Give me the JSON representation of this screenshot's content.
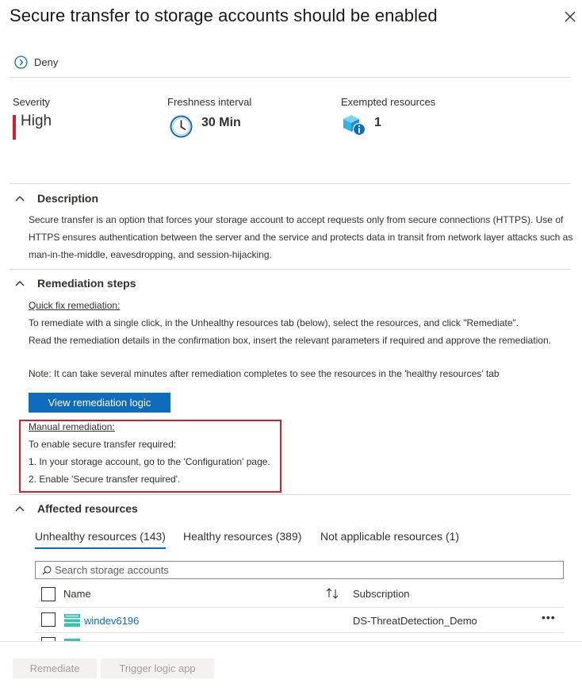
{
  "panel": {
    "title": "Secure transfer to storage accounts should be enabled",
    "effect": "Deny"
  },
  "metrics": {
    "severity_label": "Severity",
    "severity_value": "High",
    "freshness_label": "Freshness interval",
    "freshness_value": "30 Min",
    "exempted_label": "Exempted resources",
    "exempted_value": "1"
  },
  "description": {
    "heading": "Description",
    "lines": [
      "Secure transfer is an option that forces your storage account to accept requests only from secure connections (HTTPS). Use of",
      "HTTPS ensures authentication between the server and the service and protects data in transit from network layer attacks such as",
      "man-in-the-middle, eavesdropping, and session-hijacking."
    ]
  },
  "remediation": {
    "heading": "Remediation steps",
    "quick_fix_title": "Quick fix remediation:",
    "quick_fix_lines": [
      "To remediate with a single click, in the Unhealthy resources tab (below), select the resources, and click \"Remediate\".",
      "Read the remediation details in the confirmation box, insert the relevant parameters if required and approve the remediation."
    ],
    "note": "Note: It can take several minutes after remediation completes to see the resources in the 'healthy resources' tab",
    "button_label": "View remediation logic",
    "manual_title": "Manual remediation:",
    "manual_lines": [
      "To enable secure transfer required:",
      "1. In your storage account, go to the 'Configuration' page.",
      "2. Enable 'Secure transfer required'."
    ]
  },
  "affected": {
    "heading": "Affected resources",
    "tabs": [
      "Unhealthy resources (143)",
      "Healthy resources (389)",
      "Not applicable resources (1)"
    ],
    "search_placeholder": "Search storage accounts",
    "columns": {
      "name": "Name",
      "subscription": "Subscription"
    },
    "rows": [
      {
        "name": "windev6196",
        "subscription": "DS-ThreatDetection_Demo"
      }
    ]
  },
  "footer": {
    "remediate_label": "Remediate",
    "trigger_label": "Trigger logic app"
  },
  "colors": {
    "accent": "#0f6cbd",
    "severity_high": "#d3202c",
    "highlight_border": "#d3202c"
  },
  "icons": [
    "close-icon",
    "deny-icon",
    "clock-icon",
    "resource-info-icon",
    "chevron-up-icon",
    "search-icon",
    "sort-icon",
    "storage-account-icon",
    "more-icon"
  ]
}
